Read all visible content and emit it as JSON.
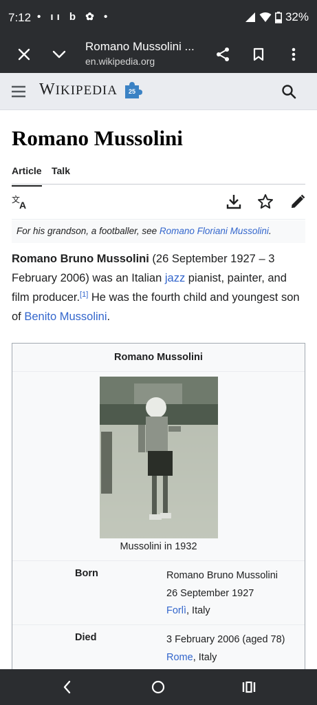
{
  "status_bar": {
    "time": "7:12",
    "notifications": "• ıı b ✿ •",
    "battery": "32%"
  },
  "custom_tab": {
    "title": "Romano Mussolini ...",
    "url": "en.wikipedia.org"
  },
  "wiki_header": {
    "wordmark_first": "W",
    "wordmark_rest": "IKIPEDIA",
    "badge": "25"
  },
  "article": {
    "title": "Romano Mussolini",
    "tabs": [
      "Article",
      "Talk"
    ],
    "hatnote_text": "For his grandson, a footballer, see ",
    "hatnote_link": "Romano Floriani Mussolini",
    "hatnote_end": ".",
    "intro": {
      "name": "Romano Bruno Mussolini",
      "text1": " (26 September 1927 – 3 February 2006) was an Italian ",
      "link_jazz": "jazz",
      "text2": " pianist, painter, and film producer.",
      "ref": "[1]",
      "text3": " He was the fourth child and youngest son of ",
      "link_father": "Benito Mussolini",
      "text4": "."
    }
  },
  "infobox": {
    "title": "Romano Mussolini",
    "caption": "Mussolini in 1932",
    "born_label": "Born",
    "born_name": "Romano Bruno Mussolini",
    "born_date": "26 September 1927",
    "born_place_link": "Forlì",
    "born_place_rest": ", Italy",
    "died_label": "Died",
    "died_date": "3 February 2006 (aged 78)",
    "died_place_link": "Rome",
    "died_place_rest": ", Italy"
  },
  "colors": {
    "link": "#3366cc",
    "chrome": "#2b2d30",
    "header_bg": "#eaecf0"
  }
}
